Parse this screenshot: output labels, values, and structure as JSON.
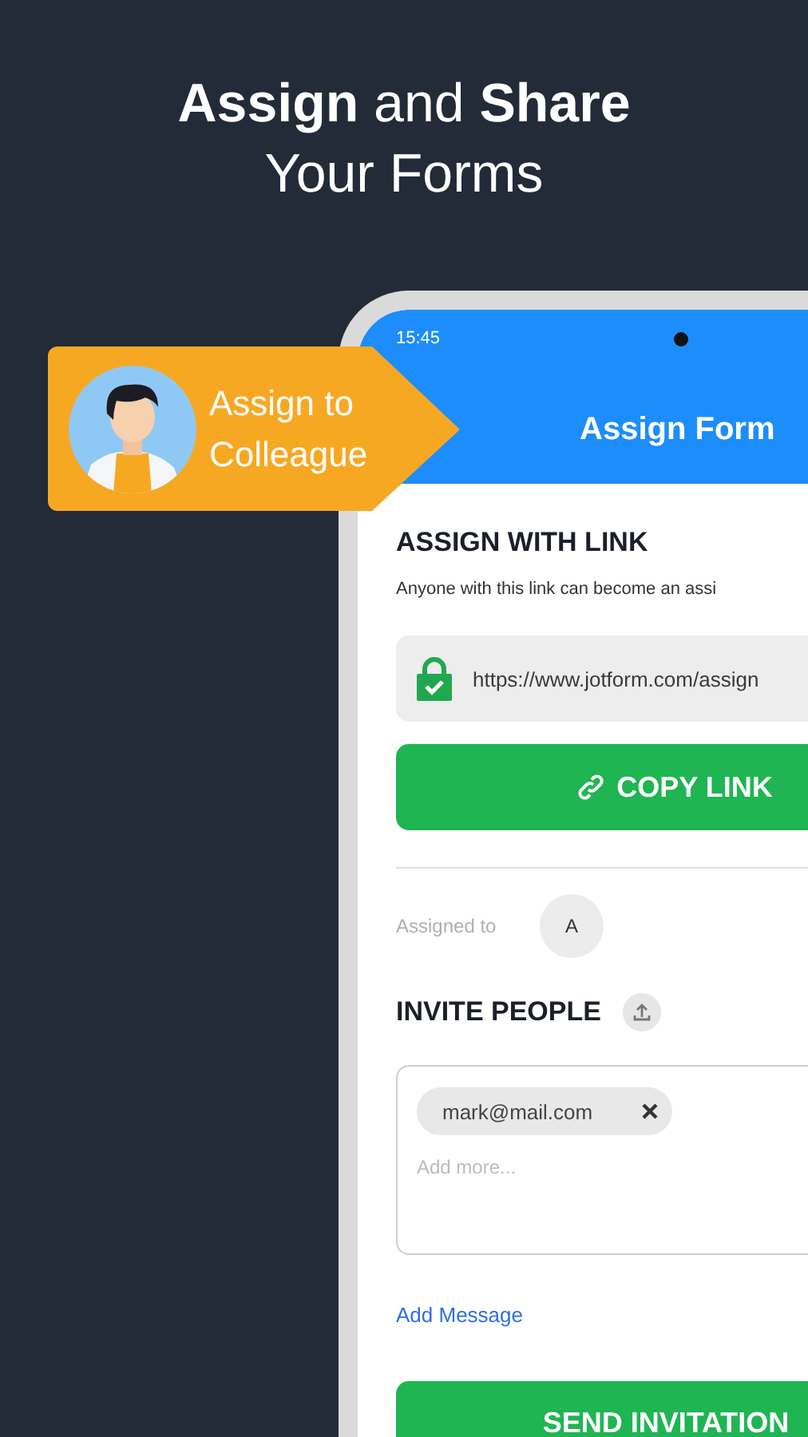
{
  "headline": {
    "line_1": "**Assign** and **Share**",
    "line_2": "Your Forms"
  },
  "callout": {
    "label": "Assign to Colleague"
  },
  "status_bar": {
    "time": "15:45"
  },
  "app_bar": {
    "title": "Assign Form"
  },
  "assign_with_link": {
    "heading": "ASSIGN WITH LINK",
    "description": "Anyone with this link can become an assi",
    "link": "https://www.jotform.com/assign",
    "copy_button": "COPY LINK"
  },
  "assigned": {
    "label": "Assigned to",
    "avatar_initial": "A"
  },
  "invite_people": {
    "heading": "INVITE PEOPLE",
    "recipients": [
      {
        "email": "mark@mail.com"
      }
    ],
    "placeholder": "Add more...",
    "add_message": "Add Message",
    "send_button": "SEND INVITATION"
  }
}
